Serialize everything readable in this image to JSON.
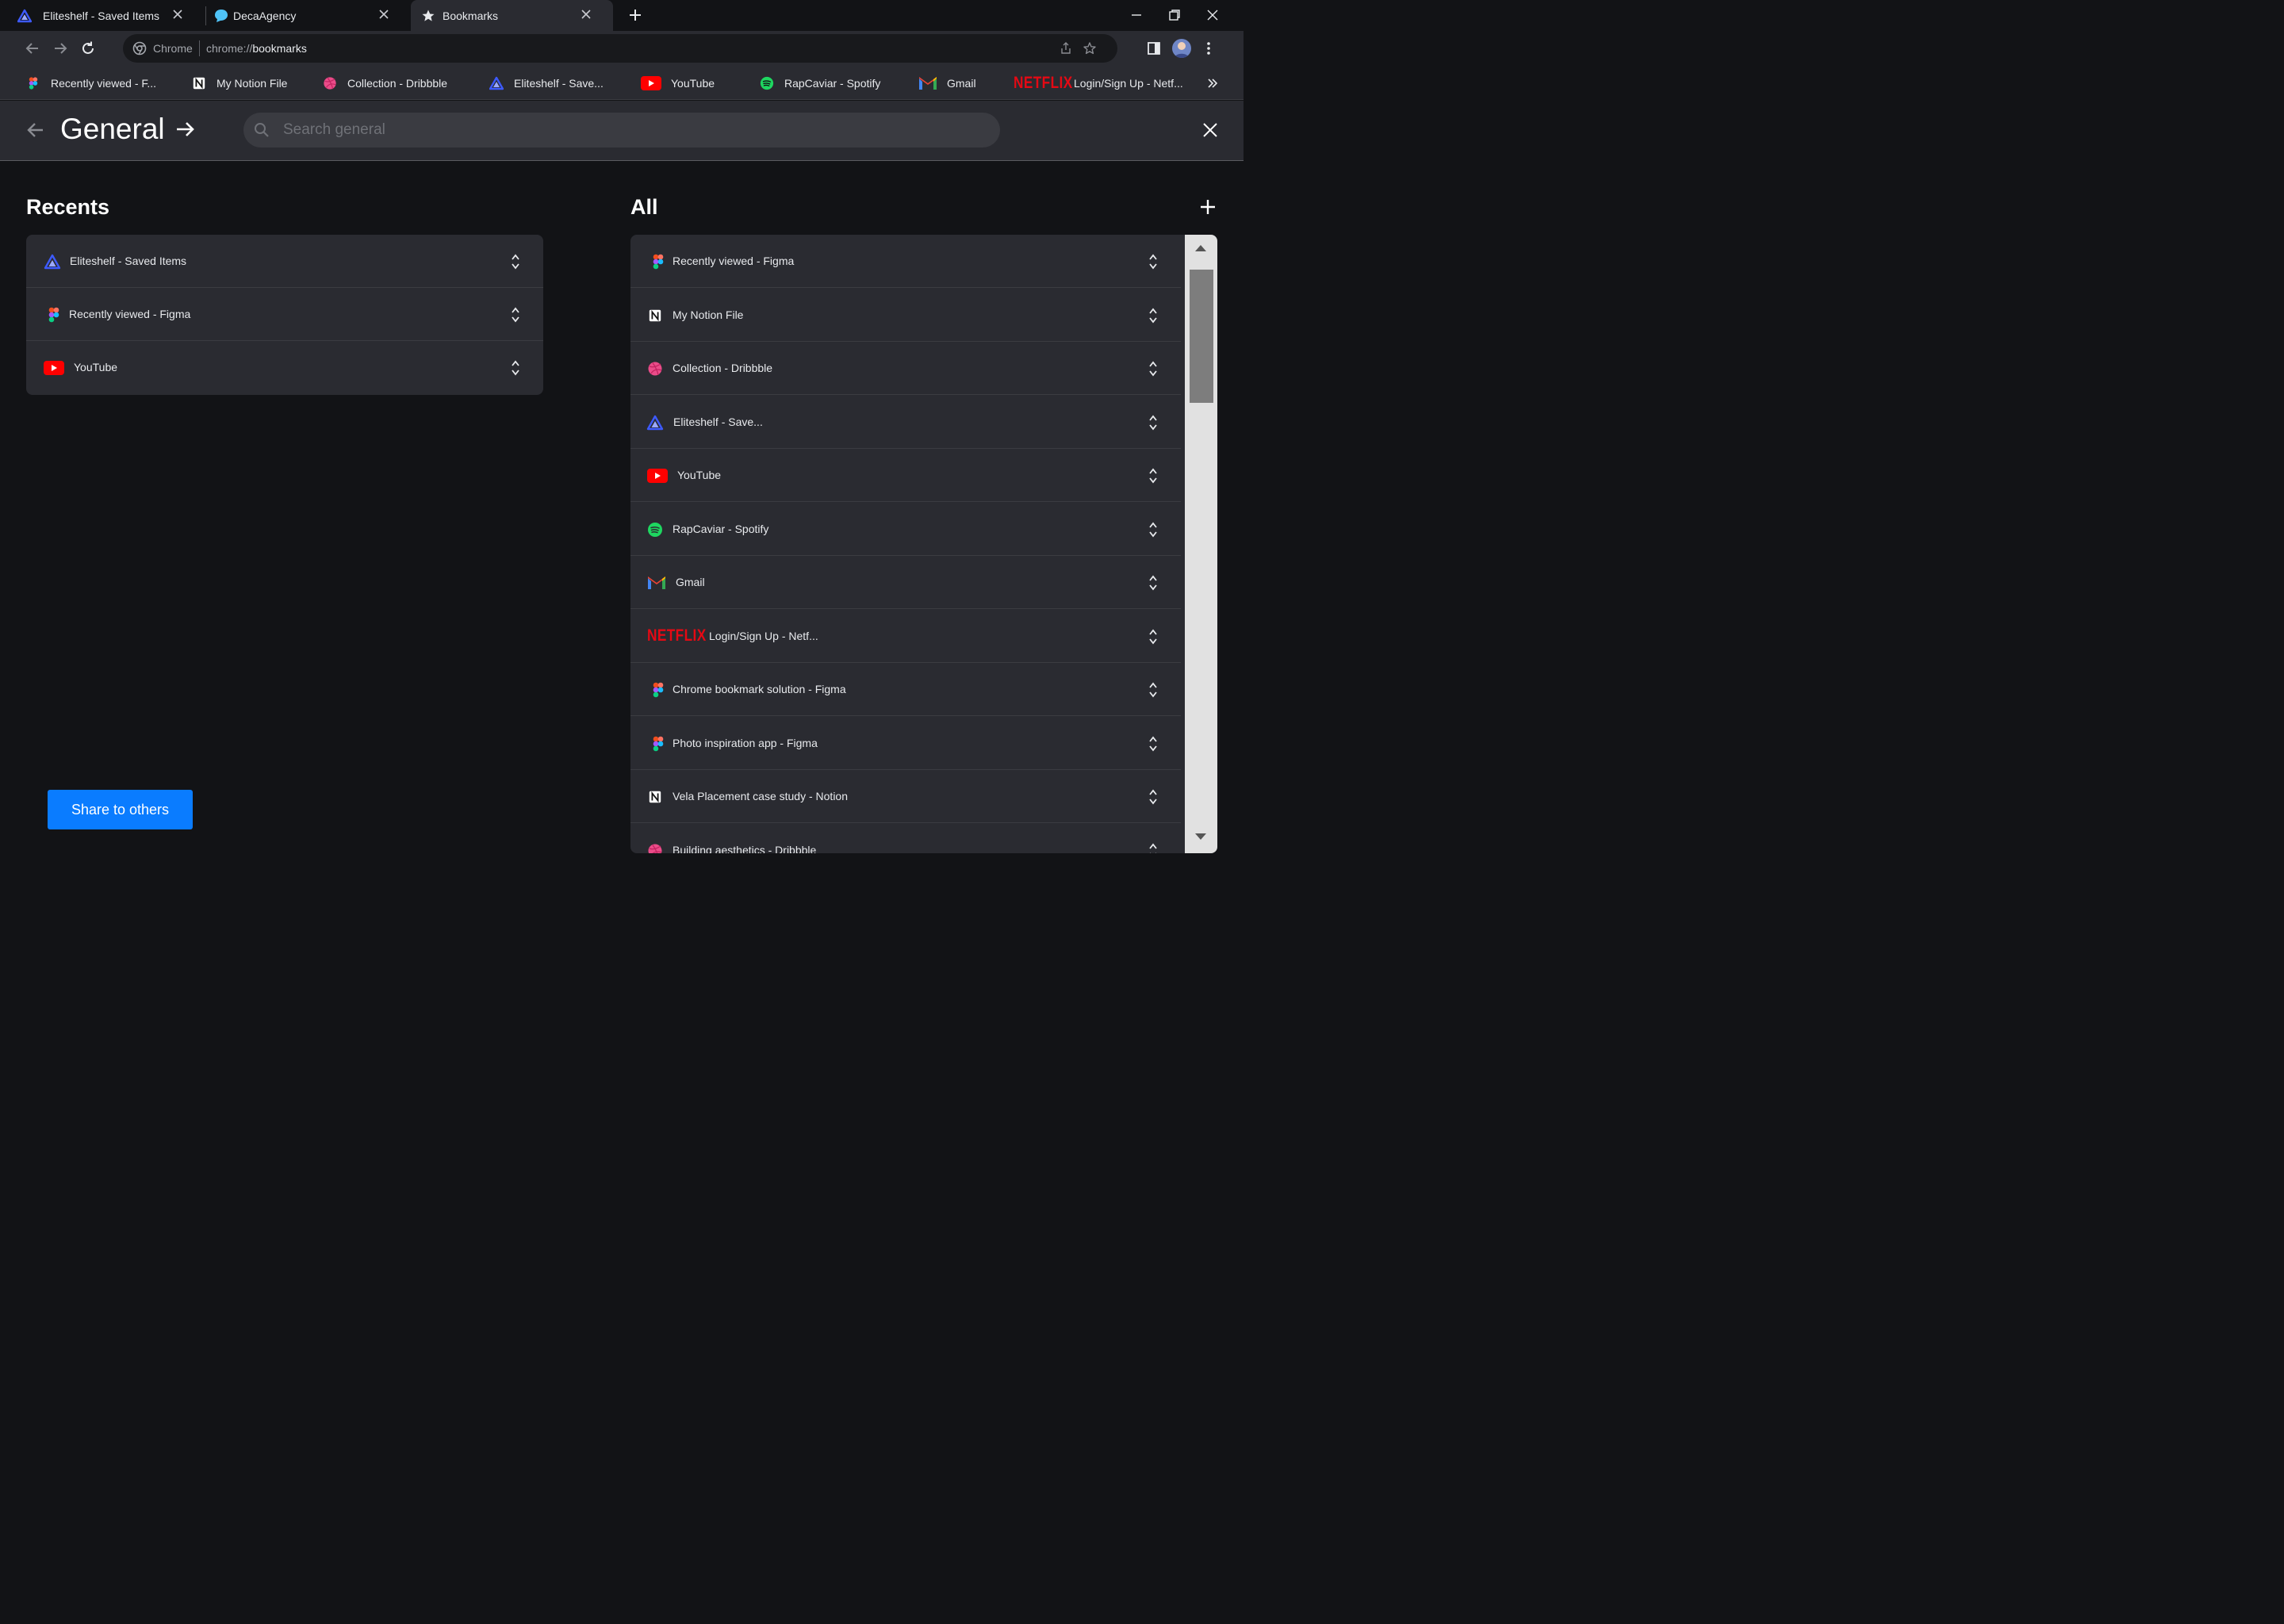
{
  "tabs": [
    {
      "title": "Eliteshelf - Saved Items",
      "icon": "eliteshelf-icon",
      "active": false
    },
    {
      "title": "DecaAgency",
      "icon": "decaagency-icon",
      "active": false
    },
    {
      "title": "Bookmarks",
      "icon": "star-icon",
      "active": true
    }
  ],
  "omnibox": {
    "chip": "Chrome",
    "url_scheme": "chrome://",
    "url_path": "bookmarks"
  },
  "bookmarks_bar": [
    {
      "label": "Recently viewed - F...",
      "icon": "figma-icon"
    },
    {
      "label": "My Notion File",
      "icon": "notion-icon"
    },
    {
      "label": "Collection - Dribbble",
      "icon": "dribbble-icon"
    },
    {
      "label": "Eliteshelf - Save...",
      "icon": "eliteshelf-icon"
    },
    {
      "label": "YouTube",
      "icon": "youtube-icon"
    },
    {
      "label": "RapCaviar - Spotify",
      "icon": "spotify-icon"
    },
    {
      "label": "Gmail",
      "icon": "gmail-icon"
    },
    {
      "label": "Login/Sign Up - Netf...",
      "icon": "netflix-icon"
    }
  ],
  "netflix_wordmark": "NETFLIX",
  "header": {
    "title": "General",
    "search_placeholder": "Search general"
  },
  "recents": {
    "title": "Recents",
    "items": [
      {
        "label": "Eliteshelf - Saved Items",
        "icon": "eliteshelf-icon"
      },
      {
        "label": "Recently viewed - Figma",
        "icon": "figma-icon"
      },
      {
        "label": "YouTube",
        "icon": "youtube-icon"
      }
    ]
  },
  "all": {
    "title": "All",
    "items": [
      {
        "label": "Recently viewed - Figma",
        "icon": "figma-icon"
      },
      {
        "label": "My Notion File",
        "icon": "notion-icon"
      },
      {
        "label": "Collection - Dribbble",
        "icon": "dribbble-icon"
      },
      {
        "label": "Eliteshelf - Save...",
        "icon": "eliteshelf-icon"
      },
      {
        "label": "YouTube",
        "icon": "youtube-icon"
      },
      {
        "label": "RapCaviar - Spotify",
        "icon": "spotify-icon"
      },
      {
        "label": "Gmail",
        "icon": "gmail-icon"
      },
      {
        "label": "Login/Sign Up - Netf...",
        "icon": "netflix-icon"
      },
      {
        "label": "Chrome bookmark solution - Figma",
        "icon": "figma-icon"
      },
      {
        "label": "Photo inspiration app - Figma",
        "icon": "figma-icon"
      },
      {
        "label": "Vela Placement case study - Notion",
        "icon": "notion-icon"
      },
      {
        "label": "Building aesthetics - Dribbble",
        "icon": "dribbble-icon"
      }
    ]
  },
  "share_button": "Share to others",
  "colors": {
    "accent": "#0a7cff",
    "youtube": "#ff0000",
    "spotify": "#1ed760",
    "netflix": "#e50914",
    "dribbble": "#ea4c89"
  }
}
